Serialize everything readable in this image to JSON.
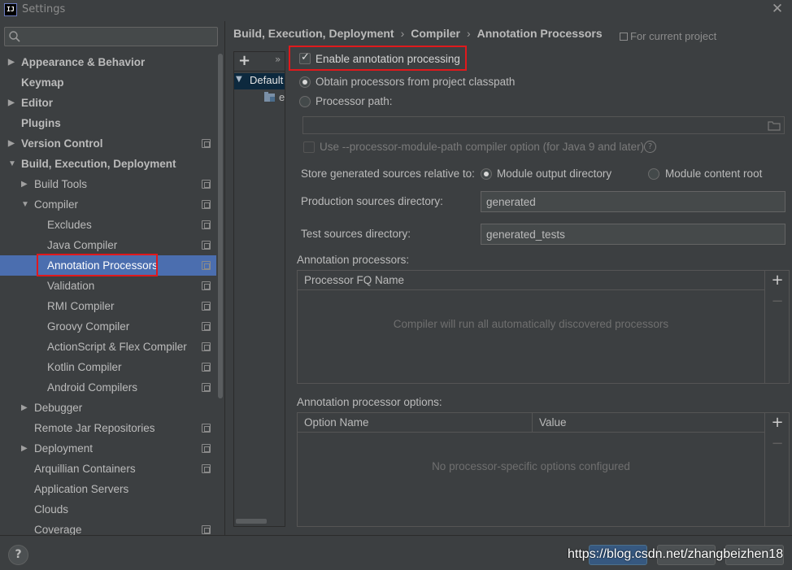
{
  "window": {
    "title": "Settings",
    "app_icon_text": "IJ",
    "close_glyph": "✕"
  },
  "search": {
    "placeholder": "",
    "value": ""
  },
  "tree": {
    "items": [
      {
        "label": "Appearance & Behavior",
        "arrow": "▶",
        "bold": true
      },
      {
        "label": "Keymap",
        "arrow": "",
        "bold": true
      },
      {
        "label": "Editor",
        "arrow": "▶",
        "bold": true
      },
      {
        "label": "Plugins",
        "arrow": "",
        "bold": true
      },
      {
        "label": "Version Control",
        "arrow": "▶",
        "bold": true,
        "project": true
      },
      {
        "label": "Build, Execution, Deployment",
        "arrow": "▼",
        "bold": true
      },
      {
        "label": "Build Tools",
        "arrow": "▶",
        "project": true
      },
      {
        "label": "Compiler",
        "arrow": "▼",
        "project": true
      },
      {
        "label": "Excludes",
        "arrow": "",
        "project": true
      },
      {
        "label": "Java Compiler",
        "arrow": "",
        "project": true
      },
      {
        "label": "Annotation Processors",
        "arrow": "",
        "project": true,
        "selected": true
      },
      {
        "label": "Validation",
        "arrow": "",
        "project": true
      },
      {
        "label": "RMI Compiler",
        "arrow": "",
        "project": true
      },
      {
        "label": "Groovy Compiler",
        "arrow": "",
        "project": true
      },
      {
        "label": "ActionScript & Flex Compiler",
        "arrow": "",
        "project": true
      },
      {
        "label": "Kotlin Compiler",
        "arrow": "",
        "project": true
      },
      {
        "label": "Android Compilers",
        "arrow": "",
        "project": true
      },
      {
        "label": "Debugger",
        "arrow": "▶"
      },
      {
        "label": "Remote Jar Repositories",
        "arrow": "",
        "project": true
      },
      {
        "label": "Deployment",
        "arrow": "▶",
        "project": true
      },
      {
        "label": "Arquillian Containers",
        "arrow": "",
        "project": true
      },
      {
        "label": "Application Servers",
        "arrow": ""
      },
      {
        "label": "Clouds",
        "arrow": ""
      },
      {
        "label": "Coverage",
        "arrow": "",
        "project": true
      }
    ]
  },
  "breadcrumb": {
    "parts": [
      "Build, Execution, Deployment",
      "Compiler",
      "Annotation Processors"
    ],
    "separator": "›"
  },
  "scope_hint": "For current project",
  "profiles": {
    "add_label": "+",
    "more_label": "»",
    "default_label": "Default",
    "default_arrow": "▼",
    "module_label": "e"
  },
  "form": {
    "enable_label": "Enable annotation processing",
    "enable_checked": true,
    "obtain_label": "Obtain processors from project classpath",
    "processor_path_label": "Processor path:",
    "processor_path_value": "",
    "module_path_label": "Use --processor-module-path compiler option (for Java 9 and later)",
    "help_glyph": "?",
    "store_label": "Store generated sources relative to:",
    "module_output_label": "Module output directory",
    "module_content_label": "Module content root",
    "production_label": "Production sources directory:",
    "production_value": "generated",
    "test_label": "Test sources directory:",
    "test_value": "generated_tests"
  },
  "processors_table": {
    "title": "Annotation processors:",
    "columns": [
      "Processor FQ Name"
    ],
    "empty_text": "Compiler will run all automatically discovered processors",
    "add": "+",
    "remove": "−"
  },
  "options_table": {
    "title": "Annotation processor options:",
    "columns": [
      "Option Name",
      "Value"
    ],
    "empty_text": "No processor-specific options configured",
    "add": "+",
    "remove": "−"
  },
  "footer": {
    "help_label": "?",
    "watermark": "https://blog.csdn.net/zhangbeizhen18"
  },
  "colors": {
    "background": "#3c3f41",
    "selection": "#4b6eaf",
    "highlight_box": "#e0191c"
  }
}
